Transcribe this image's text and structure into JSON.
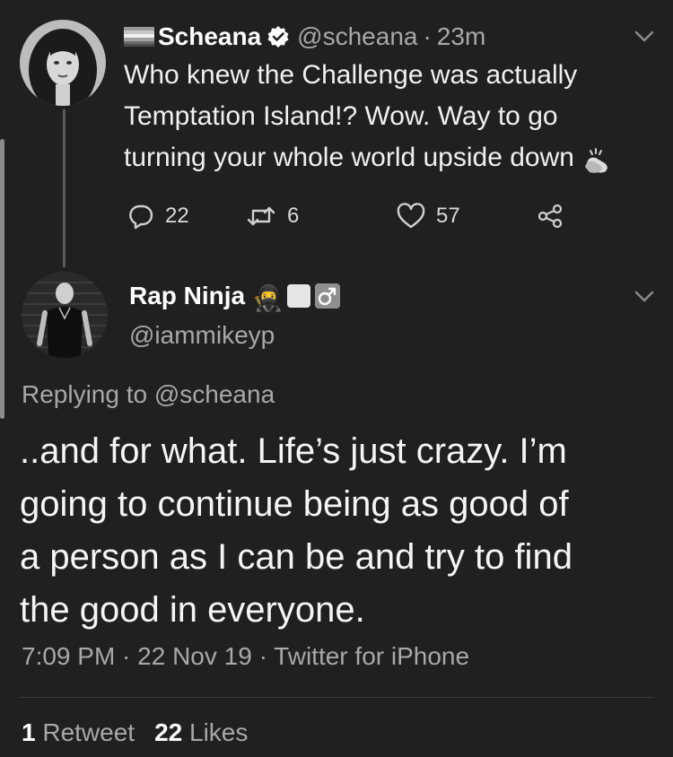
{
  "tweet1": {
    "display_name": "Scheana",
    "handle": "@scheana",
    "separator": "·",
    "time_ago": "23m",
    "text_lines": [
      "Who knew the Challenge was actually",
      "Temptation Island!? Wow. Way to go",
      "turning your whole world upside down"
    ],
    "actions": {
      "replies": "22",
      "retweets": "6",
      "likes": "57"
    },
    "icons": {
      "flag": "rainbow-flag-icon",
      "verified": "verified-badge-icon",
      "clap": "clapping-hands-icon",
      "menu": "chevron-down-icon"
    }
  },
  "tweet2": {
    "display_name": "Rap Ninja",
    "name_glyph": "🥷",
    "handle": "@iammikeyp",
    "replying_to": "Replying to @scheana",
    "text_lines": [
      "..and for what. Life’s just crazy. I’m",
      "going to continue being as good of",
      "a person as I can be and try to find",
      "the good in everyone."
    ],
    "meta": "7:09 PM · 22 Nov 19 · Twitter for iPhone",
    "stats": {
      "retweets_count": "1",
      "retweets_label": "Retweet",
      "likes_count": "22",
      "likes_label": "Likes"
    },
    "icons": {
      "box": "white-square-icon",
      "male": "male-sign-icon",
      "menu": "chevron-down-icon"
    }
  },
  "theme": {
    "background": "#202020",
    "text": "#f2f2f2",
    "muted": "#a8a8a8"
  }
}
